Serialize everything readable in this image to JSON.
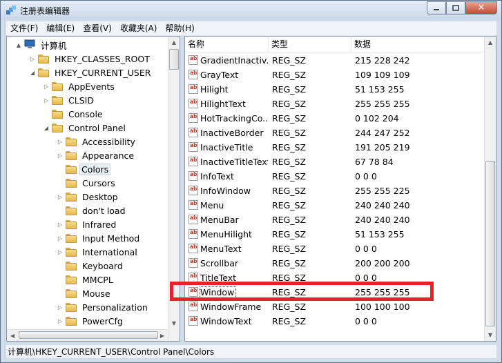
{
  "window": {
    "title": "注册表编辑器",
    "close_glyph": "✕"
  },
  "menu": [
    "文件(F)",
    "编辑(E)",
    "查看(V)",
    "收藏夹(A)",
    "帮助(H)"
  ],
  "tree": [
    {
      "label": "计算机",
      "level": 0,
      "expander": "▲",
      "icon": "computer-icon"
    },
    {
      "label": "HKEY_CLASSES_ROOT",
      "level": 1,
      "expander": "▷",
      "icon": "folder-icon"
    },
    {
      "label": "HKEY_CURRENT_USER",
      "level": 1,
      "expander": "◢",
      "icon": "folder-icon"
    },
    {
      "label": "AppEvents",
      "level": 2,
      "expander": "▷",
      "icon": "folder-icon"
    },
    {
      "label": "CLSID",
      "level": 2,
      "expander": "▷",
      "icon": "folder-icon"
    },
    {
      "label": "Console",
      "level": 2,
      "expander": "",
      "icon": "folder-icon"
    },
    {
      "label": "Control Panel",
      "level": 2,
      "expander": "◢",
      "icon": "folder-icon"
    },
    {
      "label": "Accessibility",
      "level": 3,
      "expander": "▷",
      "icon": "folder-icon"
    },
    {
      "label": "Appearance",
      "level": 3,
      "expander": "▷",
      "icon": "folder-icon"
    },
    {
      "label": "Colors",
      "level": 3,
      "expander": "",
      "icon": "folder-icon",
      "selected": true
    },
    {
      "label": "Cursors",
      "level": 3,
      "expander": "",
      "icon": "folder-icon"
    },
    {
      "label": "Desktop",
      "level": 3,
      "expander": "▷",
      "icon": "folder-icon"
    },
    {
      "label": "don't load",
      "level": 3,
      "expander": "",
      "icon": "folder-icon"
    },
    {
      "label": "Infrared",
      "level": 3,
      "expander": "▷",
      "icon": "folder-icon"
    },
    {
      "label": "Input Method",
      "level": 3,
      "expander": "▷",
      "icon": "folder-icon"
    },
    {
      "label": "International",
      "level": 3,
      "expander": "▷",
      "icon": "folder-icon"
    },
    {
      "label": "Keyboard",
      "level": 3,
      "expander": "",
      "icon": "folder-icon"
    },
    {
      "label": "MMCPL",
      "level": 3,
      "expander": "",
      "icon": "folder-icon"
    },
    {
      "label": "Mouse",
      "level": 3,
      "expander": "",
      "icon": "folder-icon"
    },
    {
      "label": "Personalization",
      "level": 3,
      "expander": "▷",
      "icon": "folder-icon"
    },
    {
      "label": "PowerCfg",
      "level": 3,
      "expander": "▷",
      "icon": "folder-icon"
    }
  ],
  "columns": [
    "名称",
    "类型",
    "数据"
  ],
  "values": [
    {
      "name": "GradientInactiv...",
      "type": "REG_SZ",
      "data": "215 228 242"
    },
    {
      "name": "GrayText",
      "type": "REG_SZ",
      "data": "109 109 109"
    },
    {
      "name": "Hilight",
      "type": "REG_SZ",
      "data": "51 153 255"
    },
    {
      "name": "HilightText",
      "type": "REG_SZ",
      "data": "255 255 255"
    },
    {
      "name": "HotTrackingCo...",
      "type": "REG_SZ",
      "data": "0 102 204"
    },
    {
      "name": "InactiveBorder",
      "type": "REG_SZ",
      "data": "244 247 252"
    },
    {
      "name": "InactiveTitle",
      "type": "REG_SZ",
      "data": "191 205 219"
    },
    {
      "name": "InactiveTitleText",
      "type": "REG_SZ",
      "data": "67 78 84"
    },
    {
      "name": "InfoText",
      "type": "REG_SZ",
      "data": "0 0 0"
    },
    {
      "name": "InfoWindow",
      "type": "REG_SZ",
      "data": "255 255 225"
    },
    {
      "name": "Menu",
      "type": "REG_SZ",
      "data": "240 240 240"
    },
    {
      "name": "MenuBar",
      "type": "REG_SZ",
      "data": "240 240 240"
    },
    {
      "name": "MenuHilight",
      "type": "REG_SZ",
      "data": "51 153 255"
    },
    {
      "name": "MenuText",
      "type": "REG_SZ",
      "data": "0 0 0"
    },
    {
      "name": "Scrollbar",
      "type": "REG_SZ",
      "data": "200 200 200"
    },
    {
      "name": "TitleText",
      "type": "REG_SZ",
      "data": "0 0 0"
    },
    {
      "name": "Window",
      "type": "REG_SZ",
      "data": "255 255 255",
      "highlighted": true
    },
    {
      "name": "WindowFrame",
      "type": "REG_SZ",
      "data": "100 100 100"
    },
    {
      "name": "WindowText",
      "type": "REG_SZ",
      "data": "0 0 0"
    }
  ],
  "status": "计算机\\HKEY_CURRENT_USER\\Control Panel\\Colors",
  "colors": {
    "highlight_border": "#e8202a",
    "selection": "#e8eef6"
  }
}
